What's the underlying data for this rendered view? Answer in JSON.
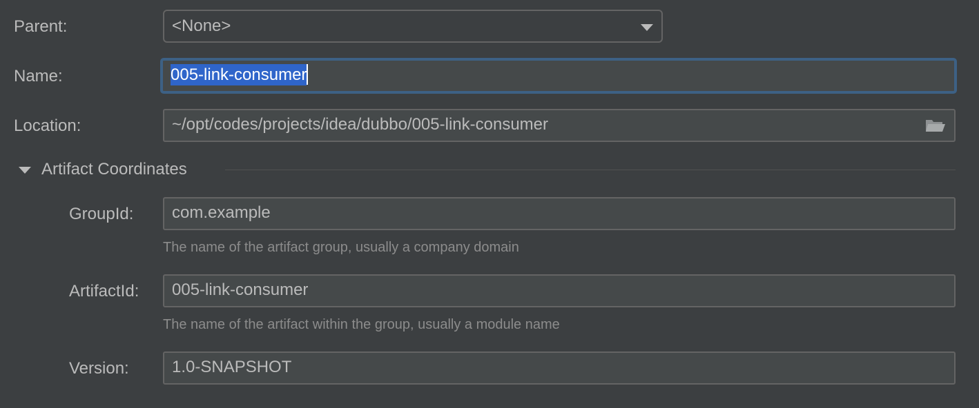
{
  "form": {
    "parent": {
      "label": "Parent:",
      "value": "<None>"
    },
    "name": {
      "label": "Name:",
      "value": "005-link-consumer"
    },
    "location": {
      "label": "Location:",
      "value": "~/opt/codes/projects/idea/dubbo/005-link-consumer",
      "browse_icon": "folder-icon"
    }
  },
  "artifact_section": {
    "title": "Artifact Coordinates",
    "expanded": true,
    "group_id": {
      "label": "GroupId:",
      "value": "com.example",
      "hint": "The name of the artifact group, usually a company domain"
    },
    "artifact_id": {
      "label": "ArtifactId:",
      "value": "005-link-consumer",
      "hint": "The name of the artifact within the group, usually a module name"
    },
    "version": {
      "label": "Version:",
      "value": "1.0-SNAPSHOT"
    }
  },
  "colors": {
    "background": "#3c3f41",
    "field_background": "#45494a",
    "focus_border": "#3d6185",
    "selection": "#2f65ca",
    "text": "#bbbbbb",
    "hint_text": "#8c8c8c"
  }
}
